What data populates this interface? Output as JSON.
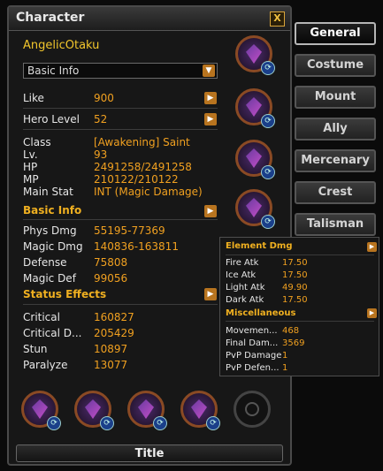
{
  "window": {
    "title": "Character",
    "close_label": "X"
  },
  "character": {
    "name": "AngelicOtaku"
  },
  "info_dropdown": {
    "selected": "Basic Info"
  },
  "stats": {
    "like_label": "Like",
    "like_value": "900",
    "hero_level_label": "Hero Level",
    "hero_level_value": "52",
    "class_label": "Class",
    "class_value": "[Awakening] Saint",
    "lv_label": "Lv.",
    "lv_value": "93",
    "hp_label": "HP",
    "hp_value": "2491258/2491258",
    "mp_label": "MP",
    "mp_value": "210122/210122",
    "main_stat_label": "Main Stat",
    "main_stat_value": "INT (Magic Damage)",
    "basic_info_header": "Basic Info",
    "phys_dmg_label": "Phys Dmg",
    "phys_dmg_value": "55195-77369",
    "magic_dmg_label": "Magic Dmg",
    "magic_dmg_value": "140836-163811",
    "defense_label": "Defense",
    "defense_value": "75808",
    "magic_def_label": "Magic Def",
    "magic_def_value": "99056",
    "status_effects_header": "Status Effects",
    "critical_label": "Critical",
    "critical_value": "160827",
    "critical_d_label": "Critical D...",
    "critical_d_value": "205429",
    "stun_label": "Stun",
    "stun_value": "10897",
    "paralyze_label": "Paralyze",
    "paralyze_value": "13077"
  },
  "extended": {
    "element_header": "Element Dmg",
    "fire_label": "Fire Atk",
    "fire_value": "17.50",
    "ice_label": "Ice Atk",
    "ice_value": "17.50",
    "light_label": "Light Atk",
    "light_value": "49.90",
    "dark_label": "Dark Atk",
    "dark_value": "17.50",
    "misc_header": "Miscellaneous",
    "movement_label": "Movemen...",
    "movement_value": "468",
    "final_label": "Final Dam...",
    "final_value": "3569",
    "pvp_damage_label": "PvP Damage",
    "pvp_damage_value": "1",
    "pvp_defense_label": "PvP Defen...",
    "pvp_defense_value": "1"
  },
  "tabs": [
    "General",
    "Costume",
    "Mount",
    "Ally",
    "Mercenary",
    "Crest",
    "Talisman"
  ],
  "active_tab": "General",
  "title_button": "Title",
  "accent": {
    "gold": "#f0b020",
    "value_orange": "#f0a020",
    "name_yellow": "#f2c62c"
  },
  "icons": [
    "close-icon",
    "dropdown-arrow-icon",
    "detail-arrow-icon",
    "swap-icon",
    "equipment-slot-icon"
  ]
}
